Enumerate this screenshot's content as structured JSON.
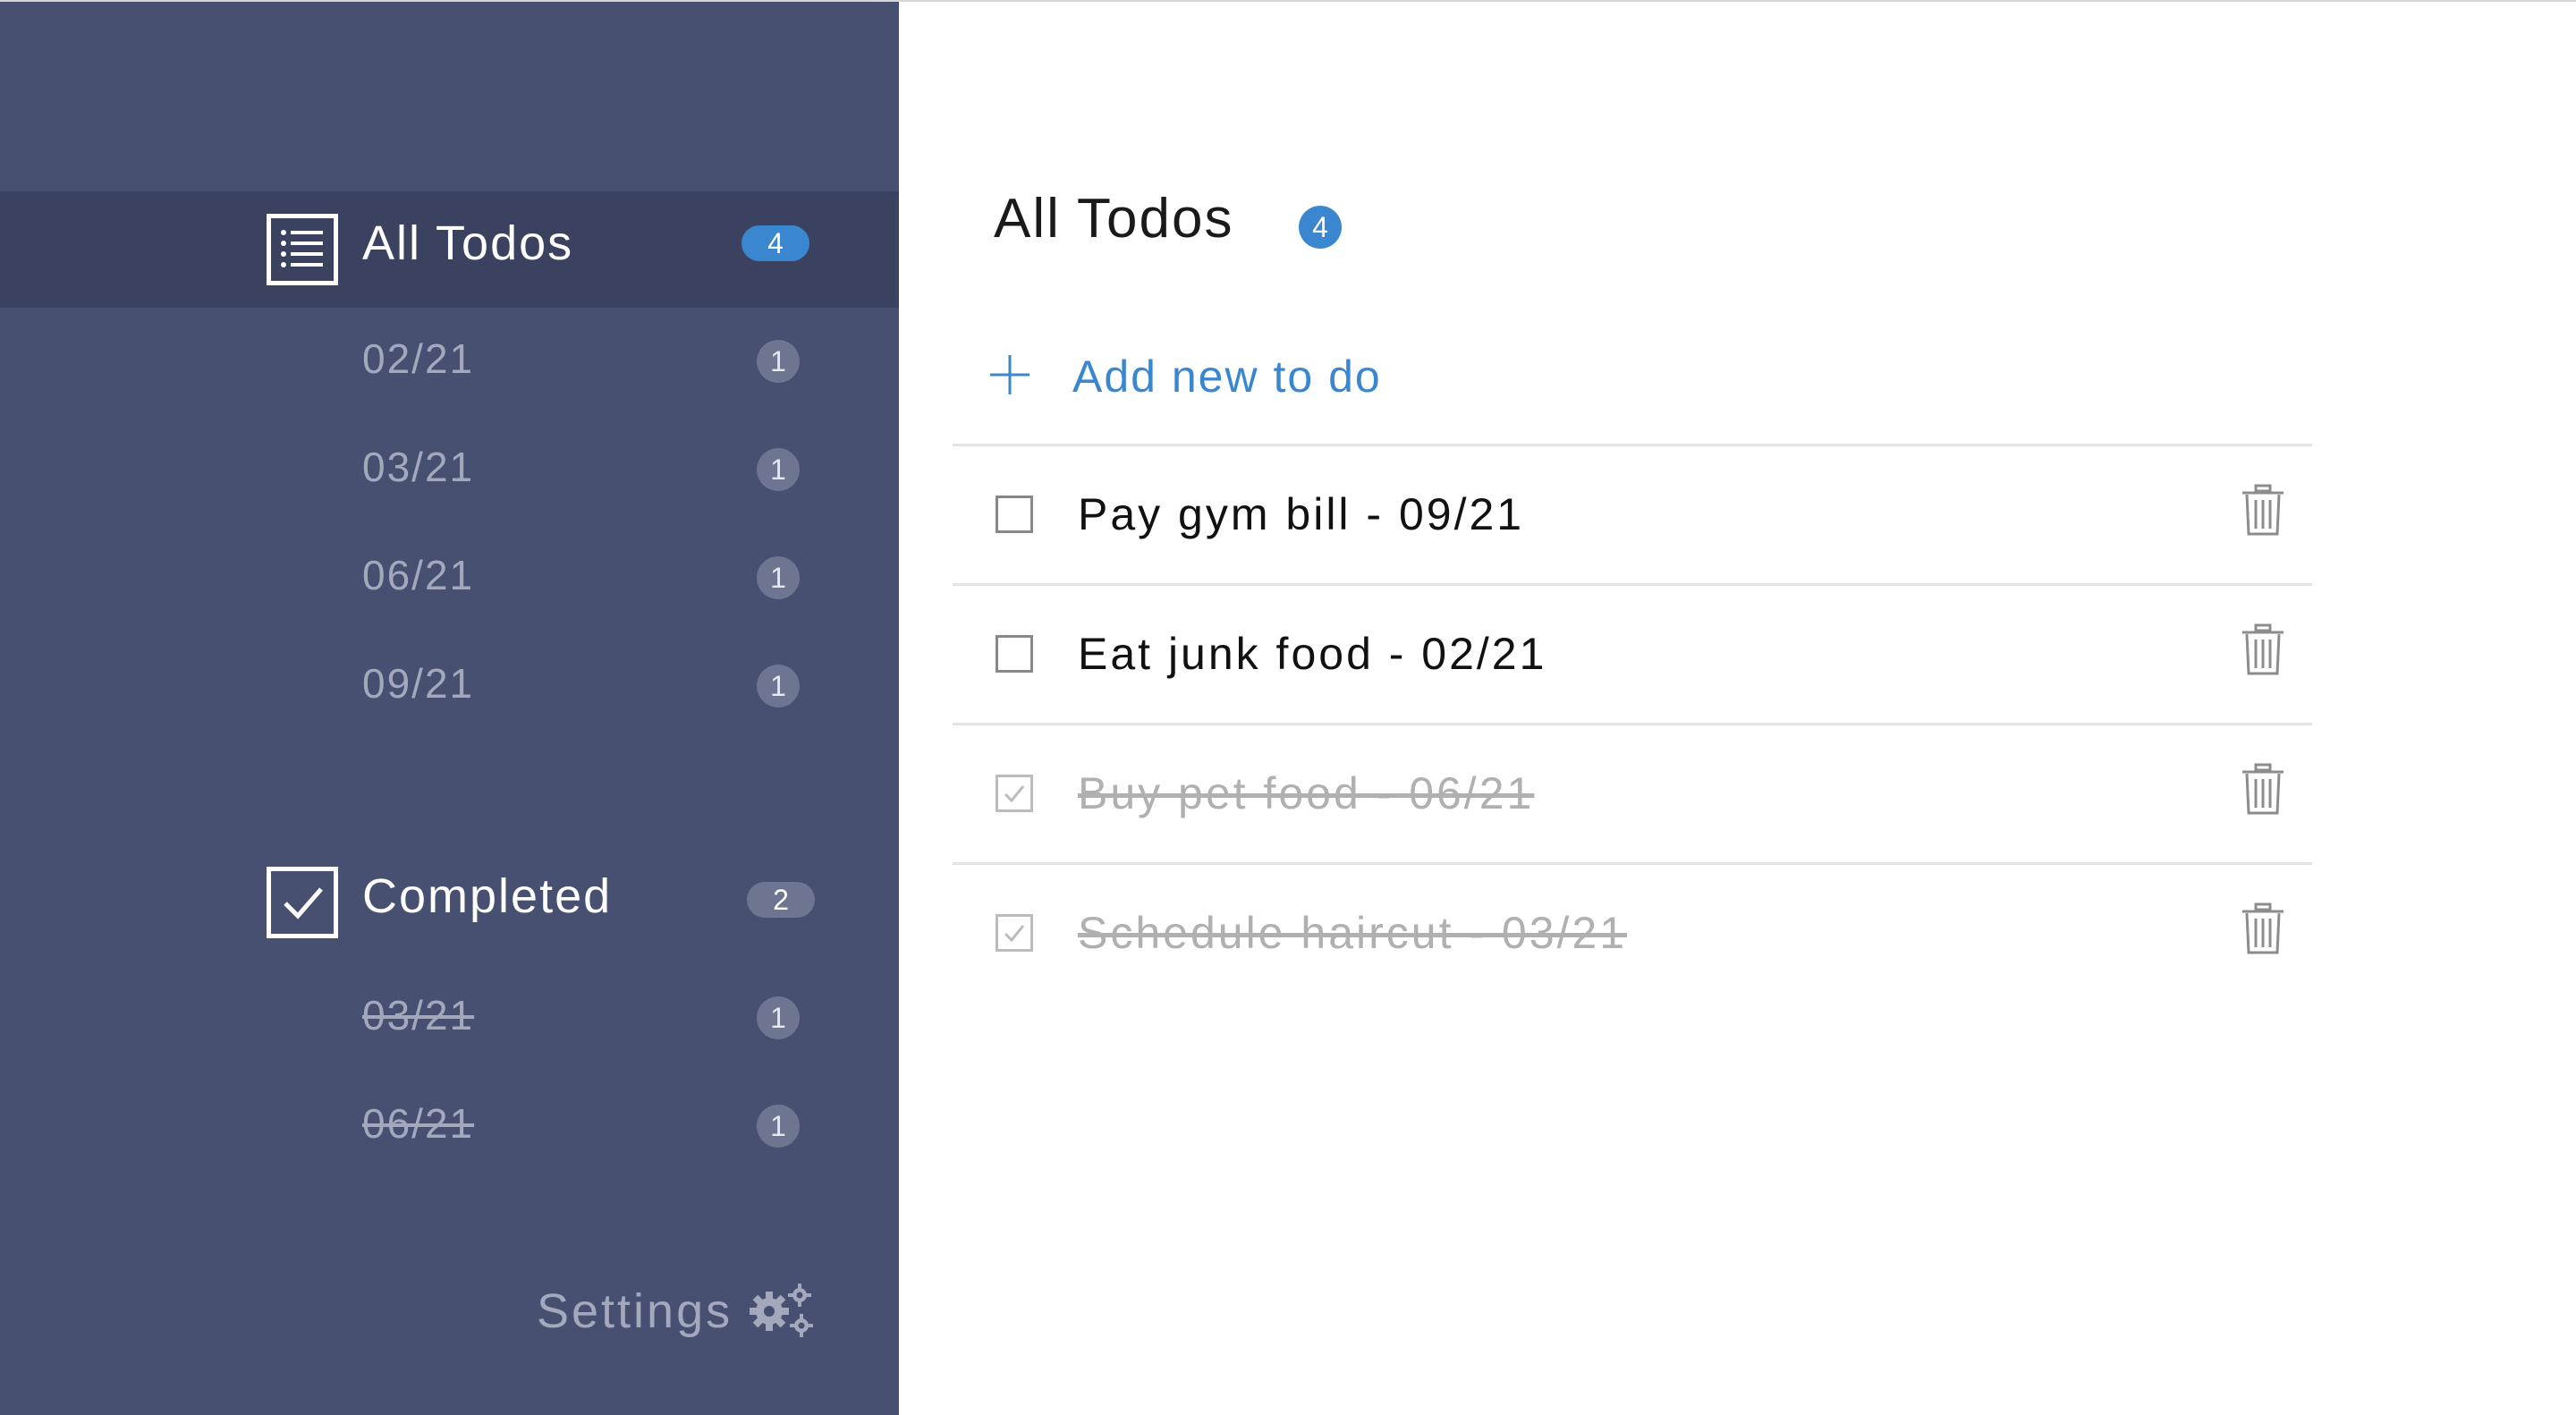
{
  "sidebar": {
    "all_todos": {
      "title": "All Todos",
      "count": "4",
      "icon": "list-icon",
      "dates": [
        {
          "label": "02/21",
          "count": "1"
        },
        {
          "label": "03/21",
          "count": "1"
        },
        {
          "label": "06/21",
          "count": "1"
        },
        {
          "label": "09/21",
          "count": "1"
        }
      ]
    },
    "completed": {
      "title": "Completed",
      "count": "2",
      "icon": "checkbox-checked-icon",
      "dates": [
        {
          "label": "03/21",
          "count": "1"
        },
        {
          "label": "06/21",
          "count": "1"
        }
      ]
    },
    "settings": {
      "label": "Settings",
      "icon": "gears-icon"
    }
  },
  "main": {
    "title": "All Todos",
    "count": "4",
    "add_label": "Add new to do",
    "todos": [
      {
        "text": "Pay gym bill - 09/21",
        "completed": false
      },
      {
        "text": "Eat junk food - 02/21",
        "completed": false
      },
      {
        "text": "Buy pet food - 06/21",
        "completed": true
      },
      {
        "text": "Schedule haircut - 03/21",
        "completed": true
      }
    ]
  },
  "colors": {
    "sidebar_bg": "#475071",
    "sidebar_active_bg": "#3b4260",
    "accent_blue": "#3a87d0",
    "muted_text": "#a3a8bd",
    "badge_grey": "#6e7591"
  }
}
